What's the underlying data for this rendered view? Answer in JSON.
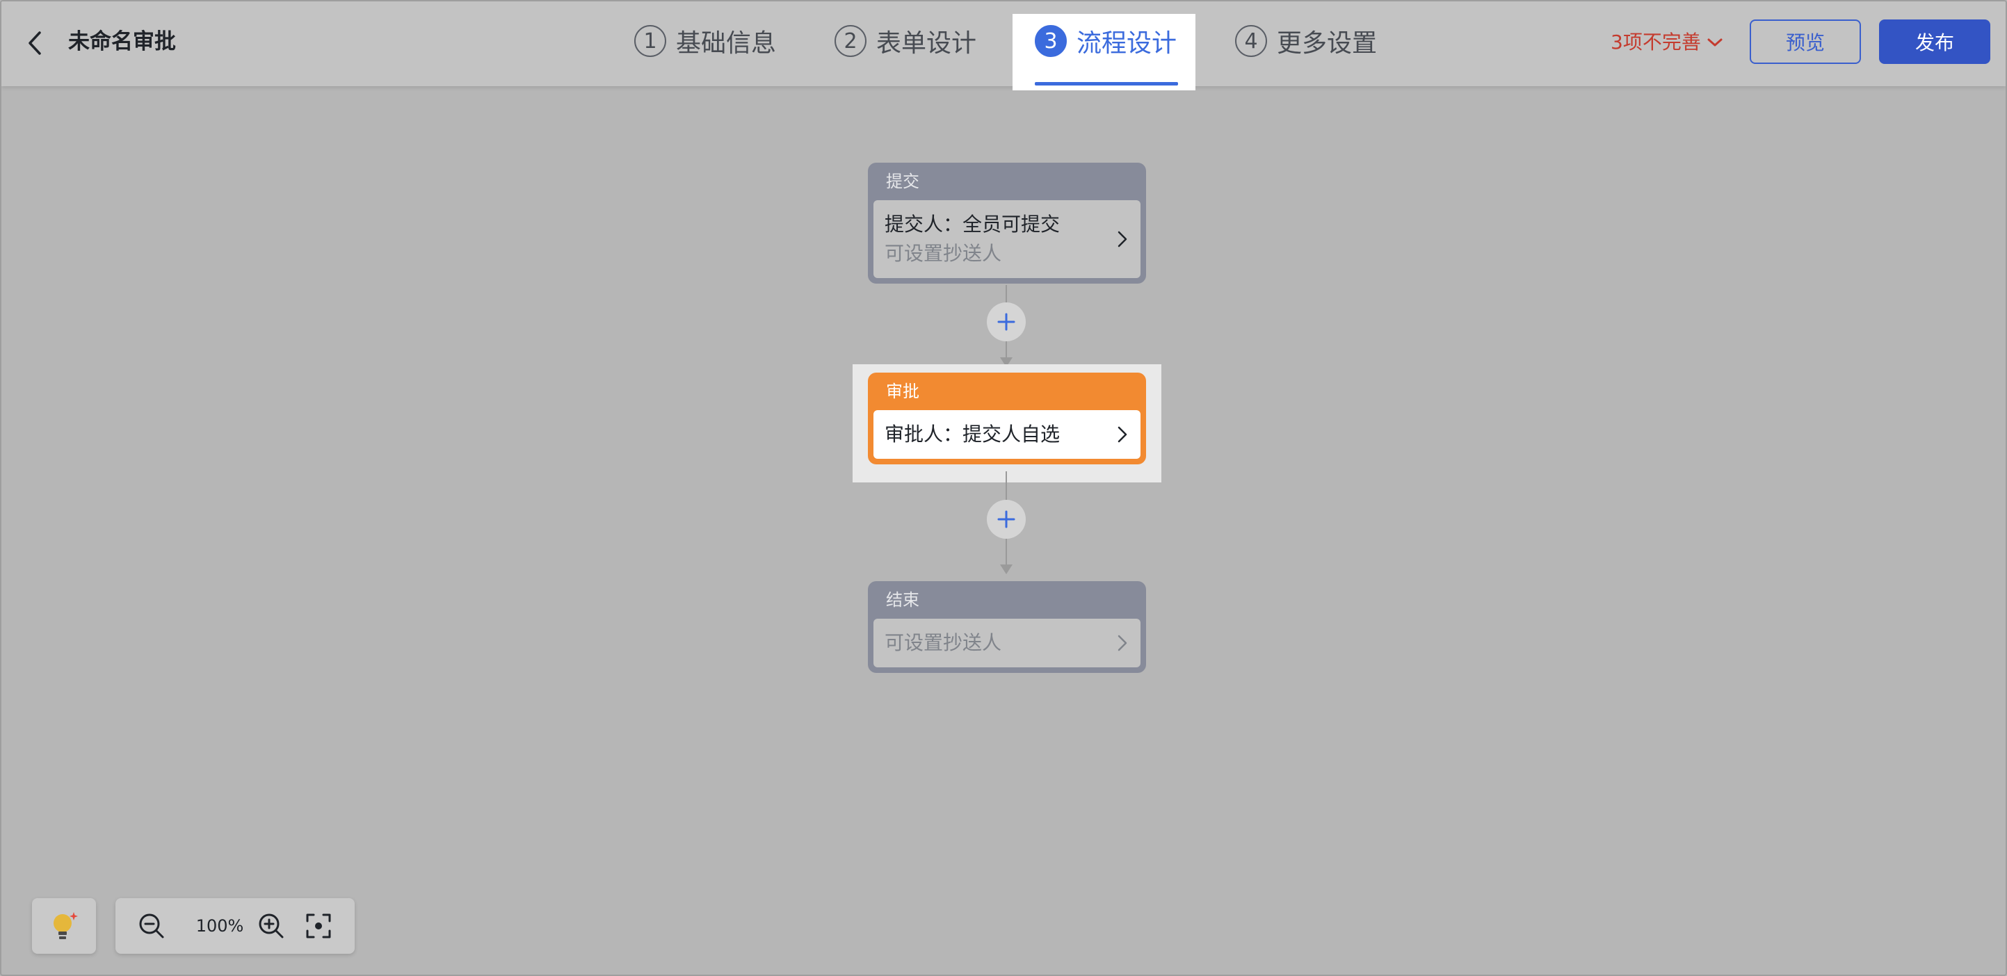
{
  "header": {
    "title": "未命名审批",
    "steps": [
      {
        "num": "1",
        "label": "基础信息"
      },
      {
        "num": "2",
        "label": "表单设计"
      },
      {
        "num": "3",
        "label": "流程设计"
      },
      {
        "num": "4",
        "label": "更多设置"
      }
    ],
    "active_step": 3,
    "incomplete_label": "3项不完善",
    "preview_label": "预览",
    "publish_label": "发布"
  },
  "flow": {
    "nodes": [
      {
        "title": "提交",
        "line1": "提交人：全员可提交",
        "line2": "可设置抄送人"
      },
      {
        "title": "审批",
        "line1": "审批人：提交人自选"
      },
      {
        "title": "结束",
        "line2": "可设置抄送人"
      }
    ]
  },
  "toolbar": {
    "zoom_level": "100%"
  },
  "colors": {
    "accent": "#3b6bdd",
    "publish": "#3354c4",
    "approval_node": "#f28a31",
    "grey_node": "#878b9a",
    "warning": "#c43b2e"
  },
  "icons": {
    "back": "chevron-left-icon",
    "incomplete_toggle": "chevron-down-icon",
    "add": "plus-icon",
    "node_arrow": "chevron-right-icon",
    "tips": "lightbulb-icon",
    "zoom_out": "zoom-out-icon",
    "zoom_in": "zoom-in-icon",
    "fit": "fit-screen-icon"
  }
}
